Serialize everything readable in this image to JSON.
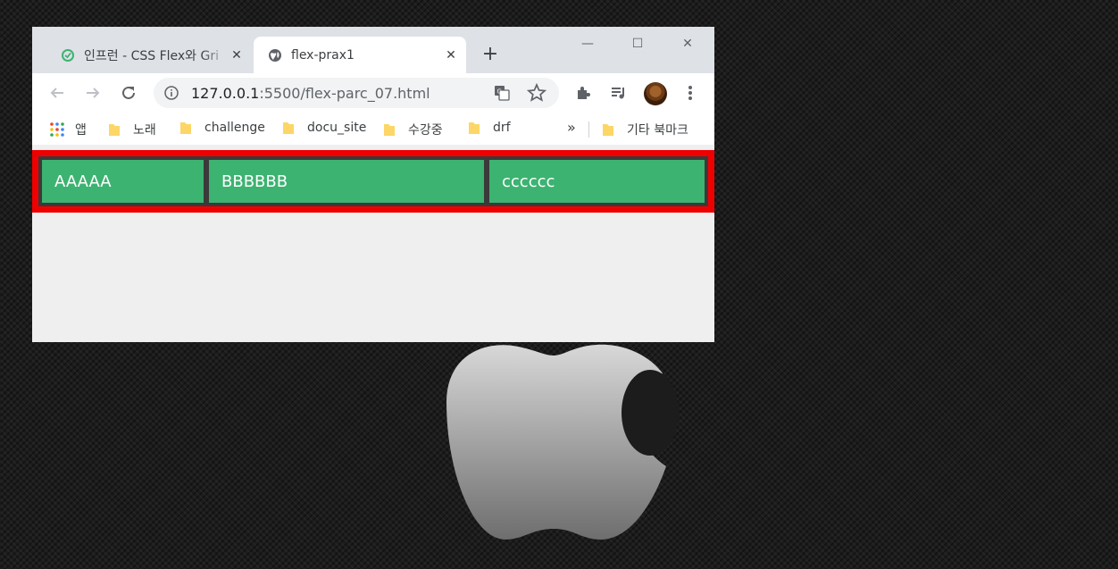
{
  "browser": {
    "tabs": [
      {
        "title": "인프런 - CSS Flex와 Gri",
        "active": false,
        "icon": "inflearn-favicon"
      },
      {
        "title": "flex-prax1",
        "active": true,
        "icon": "globe-icon"
      }
    ],
    "address_bar": {
      "host": "127.0.0.1",
      "path": ":5500/flex-parc_07.html"
    },
    "bookmarks": [
      "앱",
      "노래",
      "challenge",
      "docu_site",
      "수강중",
      "drf"
    ],
    "bookmarks_overflow": "»",
    "other_bookmarks": "기타 북마크"
  },
  "page": {
    "items": [
      "AAAAA",
      "BBBBBB",
      "cccccc"
    ]
  },
  "colors": {
    "container_border": "#ee0000",
    "item_background": "#3cb371",
    "container_background": "#3a3a3a"
  }
}
